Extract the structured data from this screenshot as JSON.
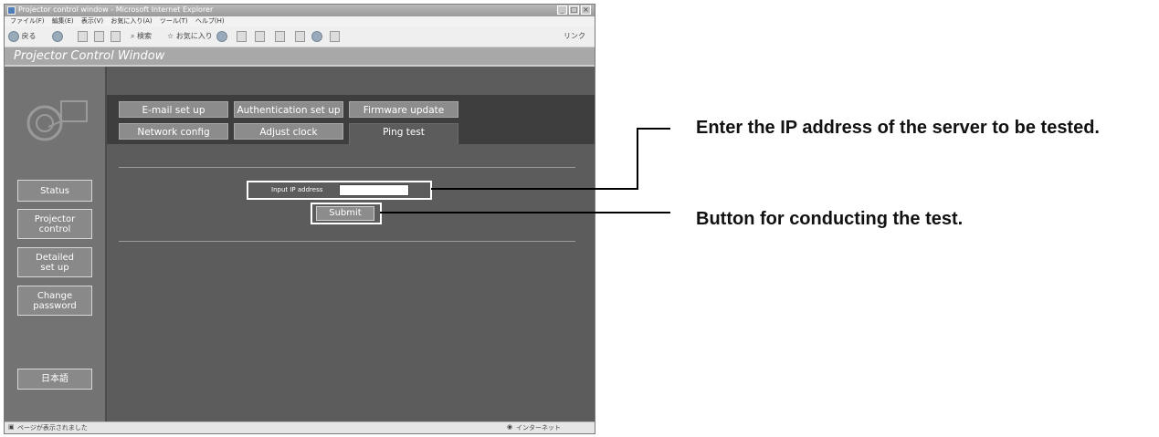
{
  "window": {
    "title": "Projector control window - Microsoft Internet Explorer",
    "min_glyph": "_",
    "max_glyph": "□",
    "close_glyph": "×"
  },
  "menu": [
    "ファイル(F)",
    "編集(E)",
    "表示(V)",
    "お気に入り(A)",
    "ツール(T)",
    "ヘルプ(H)"
  ],
  "toolbar": {
    "back_label": "戻る",
    "search_label": "検索",
    "favorites_label": "お気に入り",
    "links_label": "リンク"
  },
  "app": {
    "title": "Projector Control Window"
  },
  "sidebar": {
    "items": [
      {
        "label": "Status"
      },
      {
        "label": "Projector\ncontrol"
      },
      {
        "label": "Detailed\nset up"
      },
      {
        "label": "Change\npassword"
      },
      {
        "label": "日本語"
      }
    ]
  },
  "tabs": {
    "row1": [
      {
        "label": "E-mail set up"
      },
      {
        "label": "Authentication set up"
      },
      {
        "label": "Firmware update"
      }
    ],
    "row2": [
      {
        "label": "Network config"
      },
      {
        "label": "Adjust clock"
      },
      {
        "label": "Ping test",
        "active": true
      }
    ]
  },
  "form": {
    "ip_label": "Input IP address",
    "ip_value": "",
    "submit_label": "Submit"
  },
  "statusbar": {
    "left": "ページが表示されました",
    "right": "インターネット"
  },
  "callouts": {
    "ip": "Enter the IP address of the server to be tested.",
    "submit": "Button for conducting the test."
  }
}
